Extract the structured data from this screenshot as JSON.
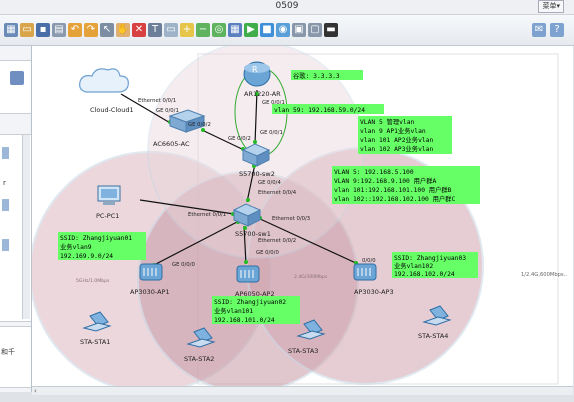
{
  "window": {
    "title": "0509",
    "menu_label": "菜单▾"
  },
  "toolbar": {
    "icons": [
      "new-topology-icon",
      "open-icon",
      "save-icon",
      "print-icon",
      "undo-icon",
      "redo-icon",
      "select-icon",
      "hand-icon",
      "delete-icon",
      "text-icon",
      "rectangle-icon",
      "zoom-in-icon",
      "zoom-out-icon",
      "fit-icon",
      "start-icon",
      "stop-icon",
      "capture-icon",
      "cli-icon",
      "settings-icon"
    ],
    "right_icons": [
      "chat-icon",
      "help-icon"
    ]
  },
  "left_panel": {
    "cut_text": "r",
    "bottom_text": "和千"
  },
  "devices": {
    "cloud": "Cloud-Cloud1",
    "ar": "AR1220-AR",
    "ac": "AC6605-AC",
    "sw2": "S5700-sw2",
    "sw1": "S5700-sw1",
    "pc": "PC-PC1",
    "ap1": "AP3030-AP1",
    "ap2": "AP6050-AP2",
    "ap3": "AP3030-AP3",
    "sta1": "STA-STA1",
    "sta2": "STA-STA2",
    "sta3": "STA-STA3",
    "sta4": "STA-STA4"
  },
  "ports": {
    "cloud_e": "Ethernet 0/0/1",
    "ac_g1": "GE 0/0/1",
    "ac_g2": "GE 0/0/2",
    "ar_g1": "GE 0/0/1",
    "sw2_g2": "GE 0/0/2",
    "sw2_g1": "GE 0/0/1",
    "sw2_g4": "GE 0/0/4",
    "sw1_e4": "Ethernet 0/0/4",
    "sw1_e1": "Ethernet 0/0/1",
    "sw1_e3": "Ethernet 0/0/3",
    "sw1_e2": "Ethernet 0/0/2",
    "ap2_g": "GE 0/0/0",
    "ap1_g": "GE 0/0/0",
    "ap3_g": "0/0/0"
  },
  "notes": {
    "gateway": "谷歌: 3.3.3.3",
    "vlan59": "vlan 59: 192.168.59.0/24",
    "vlans": [
      "VLAN 5 管理vlan",
      "vlan 9 AP1业务vlan",
      "vlan 101 AP2业务vlan",
      "vlan 102 AP3业务vlan"
    ],
    "ips": [
      "VLAN 5: 192.168.5.100",
      "VLAN 9:192.168.9.100 用户群A",
      "vlan 101:192.168.101.100 用户群B",
      "vlan 102::192.168.102.100 用户群C"
    ],
    "ap1": [
      "SSID: Zhangjiyuan01",
      "业务vlan9",
      "192.169.9.0/24"
    ],
    "ap2": [
      "SSID: Zhangjiyuan02",
      "业务vlan101",
      "192.168.101.0/24"
    ],
    "ap3": [
      "SSID: Zhangjiyuan03",
      "业务vlan102",
      "192.168.102.0/24"
    ]
  },
  "band_labels": {
    "ap1": "5GHz/1.0Mbps",
    "ap3": "2.4G/300Mbps",
    "right": "1/2.4G,600Mbps.."
  },
  "colors": {
    "note_bg": "#66ff66",
    "coverage": "#d89aa6",
    "coverage_ring": "#c3d7e6"
  }
}
